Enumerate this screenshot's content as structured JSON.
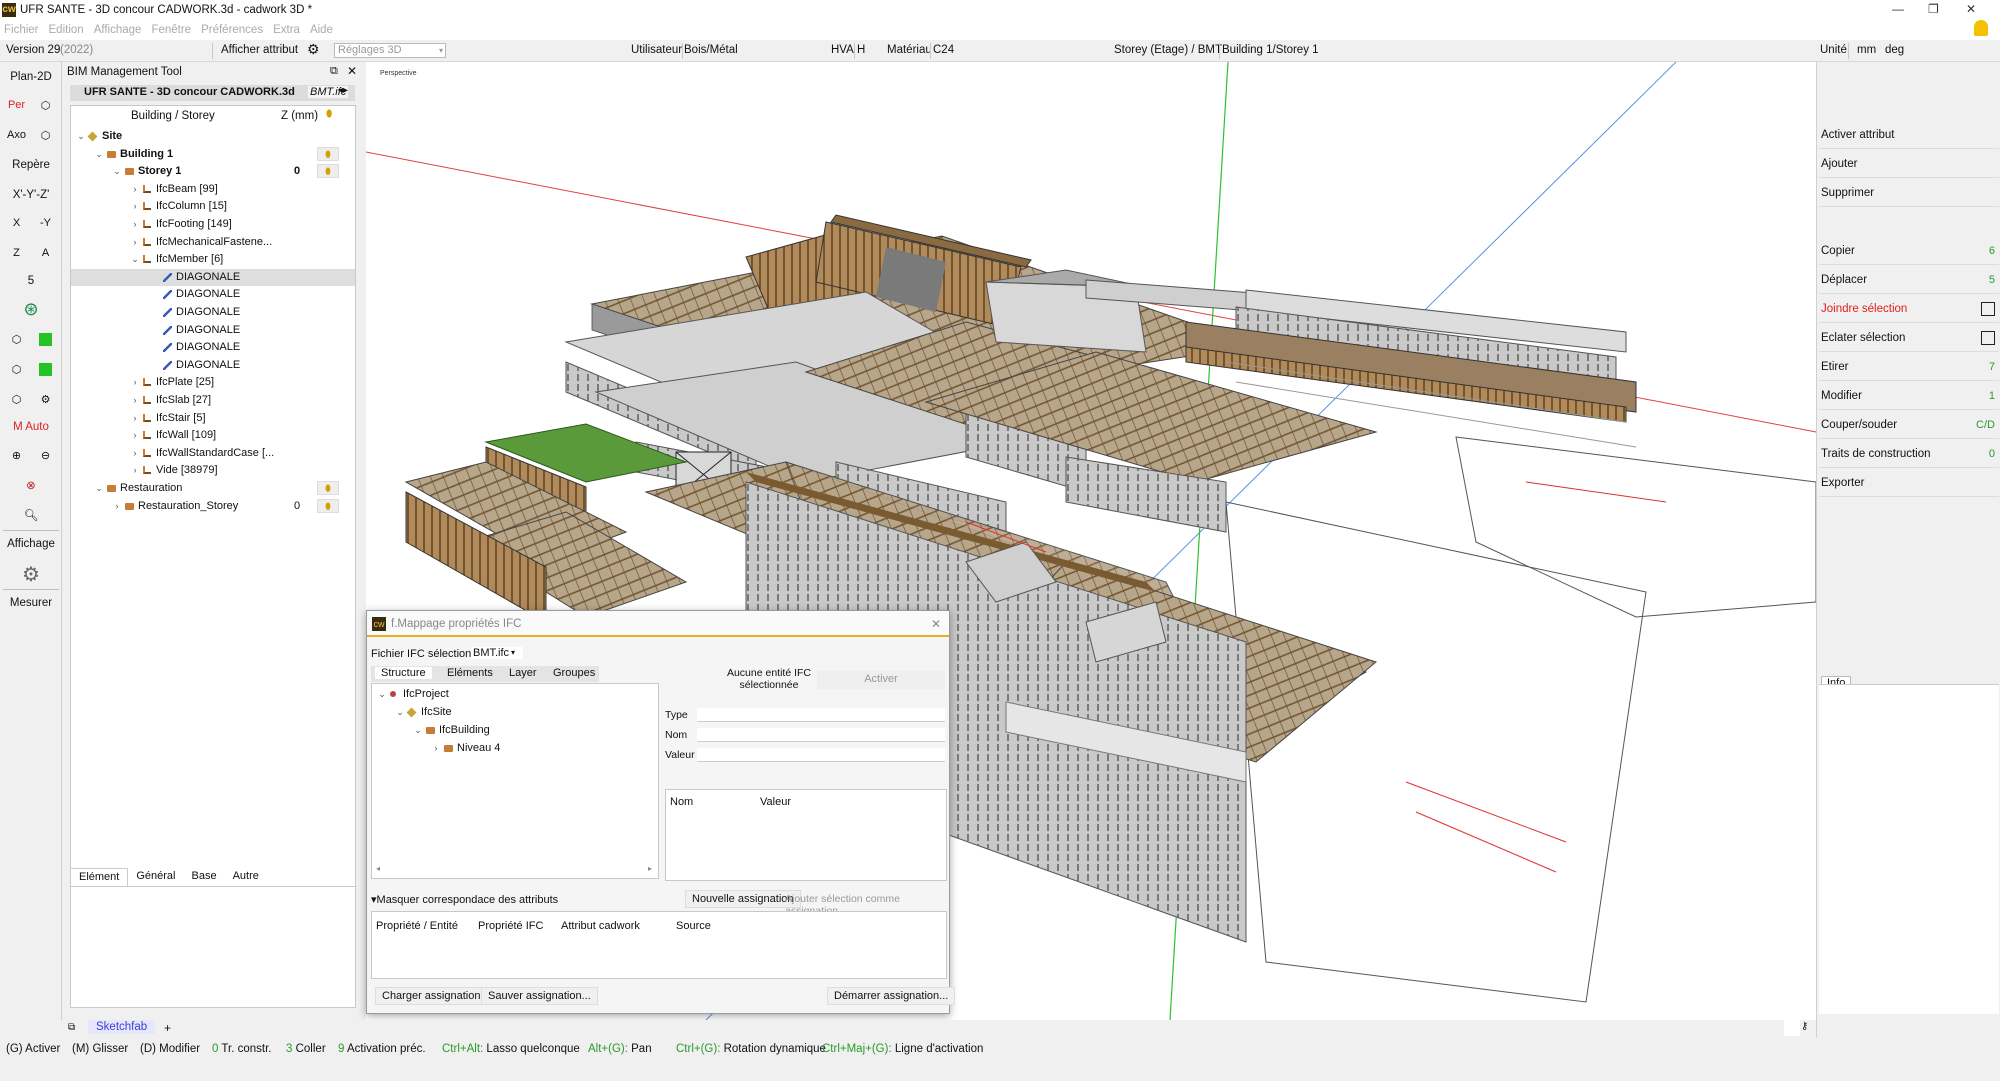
{
  "window": {
    "title": "UFR SANTE - 3D concour CADWORK.3d - cadwork 3D *",
    "logo": "cw"
  },
  "menu": [
    "Fichier",
    "Edition",
    "Affichage",
    "Fenêtre",
    "Préférences",
    "Extra",
    "Aide"
  ],
  "toolbar": {
    "version": "Version 29",
    "version_year": "(2022)",
    "show_attr": "Afficher attribut",
    "reglages": "Réglages 3D",
    "user_label": "Utilisateur",
    "user_value": "Bois/Métal",
    "hva_label": "HVA",
    "hva_value": "H",
    "material_label": "Matériau",
    "material_value": "C24",
    "storey_label": "Storey (Etage) / BMT",
    "storey_value": "Building 1/Storey 1",
    "unit_label": "Unité",
    "unit_len": "mm",
    "unit_ang": "deg"
  },
  "left_tools": {
    "plan2d": "Plan-2D",
    "per": "Per",
    "axo": "Axo",
    "repere": "Repère",
    "xyz": "X'-Y'-Z'",
    "x": "X",
    "neg_y": "-Y",
    "z": "Z",
    "a": "A",
    "five": "5",
    "mauto": "M Auto",
    "affichage": "Affichage",
    "mesurer": "Mesurer"
  },
  "bim": {
    "title": "BIM Management Tool",
    "tab_active": "UFR SANTE - 3D concour CADWORK.3d",
    "tab_other": "BMT.ifc",
    "col_name": "Building / Storey",
    "col_z": "Z (mm)",
    "tree": [
      {
        "label": "Site",
        "level": 0,
        "icon": "site",
        "bold": true,
        "exp": "v"
      },
      {
        "label": "Building 1",
        "level": 1,
        "icon": "bld",
        "bold": true,
        "exp": "v",
        "pin": true
      },
      {
        "label": "Storey 1",
        "level": 2,
        "icon": "bld",
        "bold": true,
        "exp": "v",
        "z": "0",
        "pin": true
      },
      {
        "label": "IfcBeam [99]",
        "level": 3,
        "icon": "ifc",
        "exp": ">"
      },
      {
        "label": "IfcColumn [15]",
        "level": 3,
        "icon": "ifc",
        "exp": ">"
      },
      {
        "label": "IfcFooting [149]",
        "level": 3,
        "icon": "ifc",
        "exp": ">"
      },
      {
        "label": "IfcMechanicalFastene...",
        "level": 3,
        "icon": "ifc",
        "exp": ">"
      },
      {
        "label": "IfcMember [6]",
        "level": 3,
        "icon": "ifc",
        "exp": "v"
      },
      {
        "label": "DIAGONALE",
        "level": 4,
        "icon": "diag",
        "sel": true
      },
      {
        "label": "DIAGONALE",
        "level": 4,
        "icon": "diag"
      },
      {
        "label": "DIAGONALE",
        "level": 4,
        "icon": "diag"
      },
      {
        "label": "DIAGONALE",
        "level": 4,
        "icon": "diag"
      },
      {
        "label": "DIAGONALE",
        "level": 4,
        "icon": "diag"
      },
      {
        "label": "DIAGONALE",
        "level": 4,
        "icon": "diag"
      },
      {
        "label": "IfcPlate [25]",
        "level": 3,
        "icon": "ifc",
        "exp": ">"
      },
      {
        "label": "IfcSlab [27]",
        "level": 3,
        "icon": "ifc",
        "exp": ">"
      },
      {
        "label": "IfcStair [5]",
        "level": 3,
        "icon": "ifc",
        "exp": ">"
      },
      {
        "label": "IfcWall [109]",
        "level": 3,
        "icon": "ifc",
        "exp": ">"
      },
      {
        "label": "IfcWallStandardCase [...",
        "level": 3,
        "icon": "ifc",
        "exp": ">"
      },
      {
        "label": "Vide [38979]",
        "level": 3,
        "icon": "ifc",
        "exp": ">"
      },
      {
        "label": "Restauration",
        "level": 1,
        "icon": "bld",
        "exp": "v",
        "pin": true
      },
      {
        "label": "Restauration_Storey",
        "level": 2,
        "icon": "bld",
        "exp": ">",
        "z": "0",
        "pin": true
      }
    ],
    "el_tabs": [
      "Elément",
      "Général",
      "Base",
      "Autre"
    ]
  },
  "viewport": {
    "label": "Perspective"
  },
  "right": {
    "buttons": [
      {
        "label": "Activer attribut",
        "key": "",
        "color": "#111"
      },
      {
        "label": "Ajouter",
        "key": "",
        "color": "#111"
      },
      {
        "label": "Supprimer",
        "key": "",
        "color": "#111"
      },
      {
        "label": "Copier",
        "key": "6",
        "color": "#111"
      },
      {
        "label": "Déplacer",
        "key": "5",
        "color": "#111"
      },
      {
        "label": "Joindre sélection",
        "key": "",
        "color": "#e02020",
        "icon": true
      },
      {
        "label": "Eclater sélection",
        "key": "",
        "color": "#111",
        "icon": true
      },
      {
        "label": "Etirer",
        "key": "7",
        "color": "#111"
      },
      {
        "label": "Modifier",
        "key": "1",
        "color": "#111"
      },
      {
        "label": "Couper/souder",
        "key": "C/D",
        "color": "#111"
      },
      {
        "label": "Traits de construction",
        "key": "0",
        "color": "#111"
      },
      {
        "label": "Exporter",
        "key": "",
        "color": "#111"
      }
    ],
    "info": "Info"
  },
  "dialog": {
    "title": "f.Mappage propriétés IFC",
    "file_label": "Fichier IFC sélectionné",
    "file_value": "BMT.ifc",
    "tabs": [
      "Structure",
      "Eléments",
      "Layer",
      "Groupes"
    ],
    "no_entity": "Aucune entité IFC sélectionnée",
    "activate": "Activer",
    "tree": [
      {
        "label": "IfcProject",
        "level": 0,
        "exp": "v"
      },
      {
        "label": "IfcSite",
        "level": 1,
        "exp": "v"
      },
      {
        "label": "IfcBuilding",
        "level": 2,
        "exp": "v"
      },
      {
        "label": "Niveau 4",
        "level": 3,
        "exp": ">"
      }
    ],
    "f_type": "Type",
    "f_nom": "Nom",
    "f_valeur": "Valeur",
    "col_nom": "Nom",
    "col_valeur": "Valeur",
    "hide_map": "Masquer correspondace des attributs",
    "new_assign": "Nouvelle assignation",
    "add_sel": "Ajouter sélection comme assignation",
    "cols": [
      "Propriété / Entité",
      "Propriété IFC",
      "Attribut cadwork",
      "Source"
    ],
    "load": "Charger assignation...",
    "save": "Sauver assignation...",
    "start": "Démarrer assignation..."
  },
  "sketch": {
    "tab": "Sketchfab",
    "plus": "+"
  },
  "status": [
    {
      "k": "(G)",
      "t": "Activer"
    },
    {
      "k": "(M)",
      "t": "Glisser"
    },
    {
      "k": "(D)",
      "t": "Modifier"
    },
    {
      "k": "0",
      "t": "Tr. constr.",
      "g": true
    },
    {
      "k": "3",
      "t": "Coller",
      "g": true
    },
    {
      "k": "9",
      "t": "Activation préc.",
      "g": true
    },
    {
      "k": "Ctrl+Alt:",
      "t": "Lasso quelconque",
      "g": true
    },
    {
      "k": "Alt+(G):",
      "t": "Pan",
      "g": true
    },
    {
      "k": "Ctrl+(G):",
      "t": "Rotation dynamique",
      "g": true
    },
    {
      "k": "Ctrl+Maj+(G):",
      "t": "Ligne d'activation",
      "g": true
    }
  ]
}
